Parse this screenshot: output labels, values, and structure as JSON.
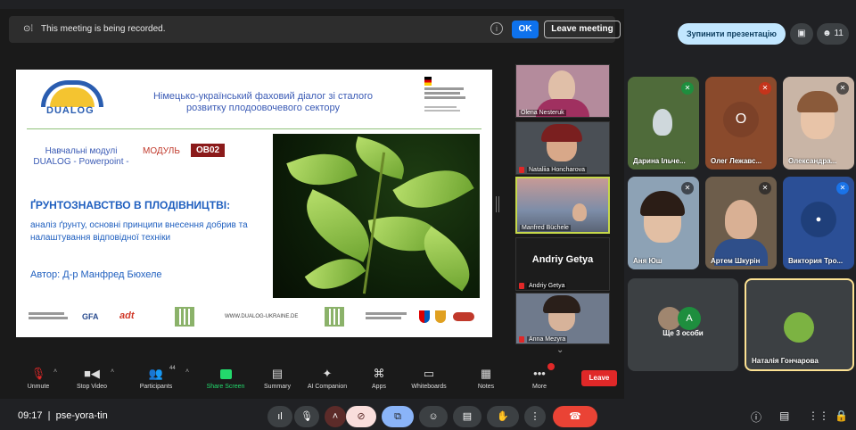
{
  "zoom": {
    "banner": {
      "record_icon": "record-icon",
      "text": "This meeting is being recorded.",
      "info_icon": "i",
      "ok_label": "OK",
      "leave_meeting_label": "Leave meeting"
    },
    "slide": {
      "logo_text": "DUALOG",
      "title": "Німецько-український фаховий діалог зі сталого розвитку плодоовочевого сектору",
      "modules_text": "Навчальні модулі DUALOG - Powerpoint -",
      "module_label": "МОДУЛЬ",
      "module_code": "OB02",
      "main_title": "ҐРУНТОЗНАВСТВО В ПЛОДІВНИЦТВІ:",
      "sub_title": "аналіз ґрунту, основні принципи внесення добрив та налаштування відповідної техніки",
      "author": "Автор:  Д-р Манфред Бюхеле",
      "gfa": "GFA",
      "adt": "adt",
      "url": "WWW.DUALOG-UKRAINE.DE"
    },
    "participants": [
      {
        "name": "Olena Nesteruk"
      },
      {
        "name": "Nataliia Honcharova"
      },
      {
        "name": "Manfred Büchele"
      },
      {
        "name": "Andriy Getya",
        "big_name": "Andriy Getya"
      },
      {
        "name": "Anna Mezyra"
      }
    ],
    "toolbar": [
      {
        "label": "Unmute",
        "icon": "mic-off-icon"
      },
      {
        "label": "Stop Video",
        "icon": "video-icon"
      },
      {
        "label": "Participants",
        "icon": "participants-icon",
        "count": "44"
      },
      {
        "label": "Share Screen",
        "icon": "share-screen-icon"
      },
      {
        "label": "Summary",
        "icon": "summary-icon"
      },
      {
        "label": "AI Companion",
        "icon": "ai-companion-icon"
      },
      {
        "label": "Apps",
        "icon": "apps-icon"
      },
      {
        "label": "Whiteboards",
        "icon": "whiteboard-icon"
      },
      {
        "label": "Notes",
        "icon": "notes-icon"
      },
      {
        "label": "More",
        "icon": "more-icon"
      }
    ],
    "leave_label": "Leave",
    "colors": {
      "share_green": "#23d96c",
      "leave_red": "#e02828",
      "ok_blue": "#0e72ed"
    }
  },
  "meet": {
    "stop_presenting": "Зупинити презентацію",
    "people_count": "11",
    "tiles": [
      {
        "name": "Дарина Ільче..."
      },
      {
        "name": "Олег Лежавс...",
        "initial": "О"
      },
      {
        "name": "Олександра..."
      },
      {
        "name": "Аня Юш"
      },
      {
        "name": "Артем Шкурін"
      },
      {
        "name": "Виктория Тро..."
      },
      {
        "name": "Ще 3 особи",
        "initial": "A"
      },
      {
        "name": "Наталія Гончарова"
      }
    ],
    "time": "09:17",
    "meeting_code": "pse-yora-tin",
    "colors": {
      "active_border": "#fde293",
      "stop_btn": "#c2e7ff",
      "end_call": "#ea4335"
    }
  }
}
